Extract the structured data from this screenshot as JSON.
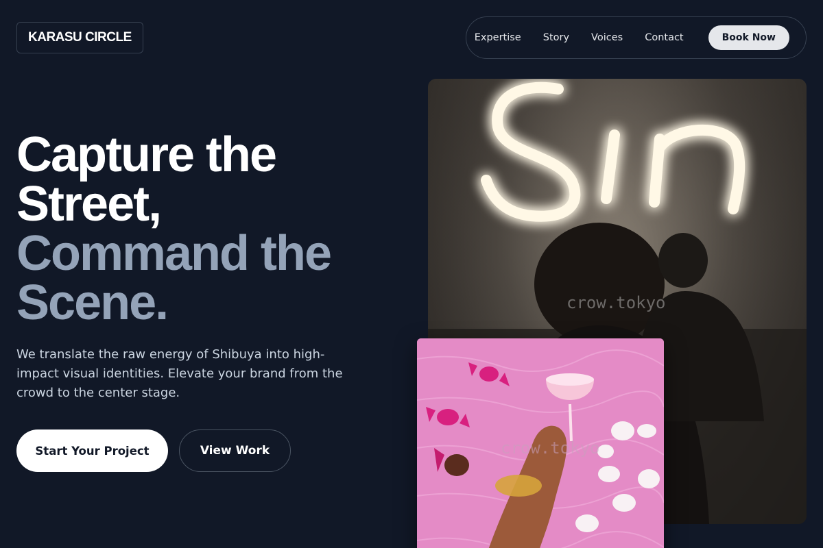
{
  "header": {
    "logo": "KARASU CIRCLE",
    "nav": [
      {
        "label": "Expertise"
      },
      {
        "label": "Story"
      },
      {
        "label": "Voices"
      },
      {
        "label": "Contact"
      }
    ],
    "cta": "Book Now"
  },
  "hero": {
    "headline_lines": [
      "Capture the",
      "Street,",
      "Command the",
      "Scene."
    ],
    "subtitle": "We translate the raw energy of Shibuya into high-impact visual identities. Elevate your brand from the crowd to the center stage.",
    "primary_cta": "Start Your Project",
    "secondary_cta": "View Work"
  },
  "images": {
    "neon": {
      "neon_sign": "Sin",
      "watermark": "crow.tokyo"
    },
    "pink": {
      "watermark": "crow.tokyo"
    }
  },
  "colors": {
    "background": "#111827",
    "headline_white": "#ffffff",
    "headline_muted": "#94a3b8",
    "body_text": "#cbd5e1",
    "nav_button_bg": "#e5e7eb"
  }
}
